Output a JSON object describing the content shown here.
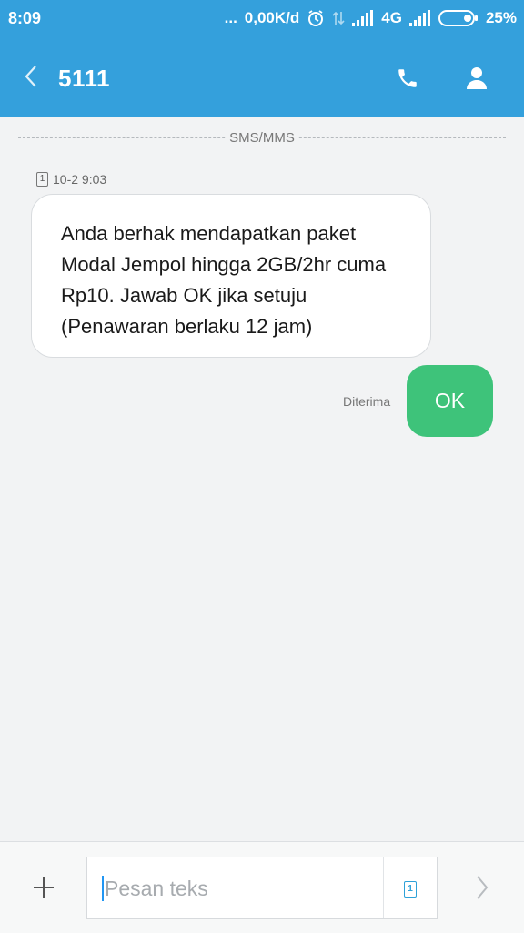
{
  "status_bar": {
    "time": "8:09",
    "more_dots": "...",
    "data_speed": "0,00K/d",
    "network_type": "4G",
    "battery_percent": "25%",
    "icons": [
      "alarm-icon",
      "data-transfer-icon",
      "signal-icon",
      "signal-icon",
      "battery-icon"
    ]
  },
  "header": {
    "title": "5111",
    "back_icon": "chevron-left-icon",
    "call_icon": "phone-icon",
    "contact_icon": "person-icon"
  },
  "conversation": {
    "channel_label": "SMS/MMS",
    "incoming": {
      "sim": "1",
      "timestamp": "10-2 9:03",
      "text": "Anda berhak mendapatkan paket Modal Jempol hingga 2GB/2hr cuma Rp10. Jawab OK jika setuju (Penawaran berlaku 12 jam)"
    },
    "outgoing": {
      "status": "Diterima",
      "text": "OK"
    }
  },
  "composer": {
    "placeholder": "Pesan teks",
    "sim": "1",
    "add_icon": "plus-icon",
    "send_icon": "chevron-right-icon"
  },
  "colors": {
    "header": "#34a0dc",
    "outgoing_bubble": "#3ec37a",
    "background": "#f2f3f4"
  }
}
